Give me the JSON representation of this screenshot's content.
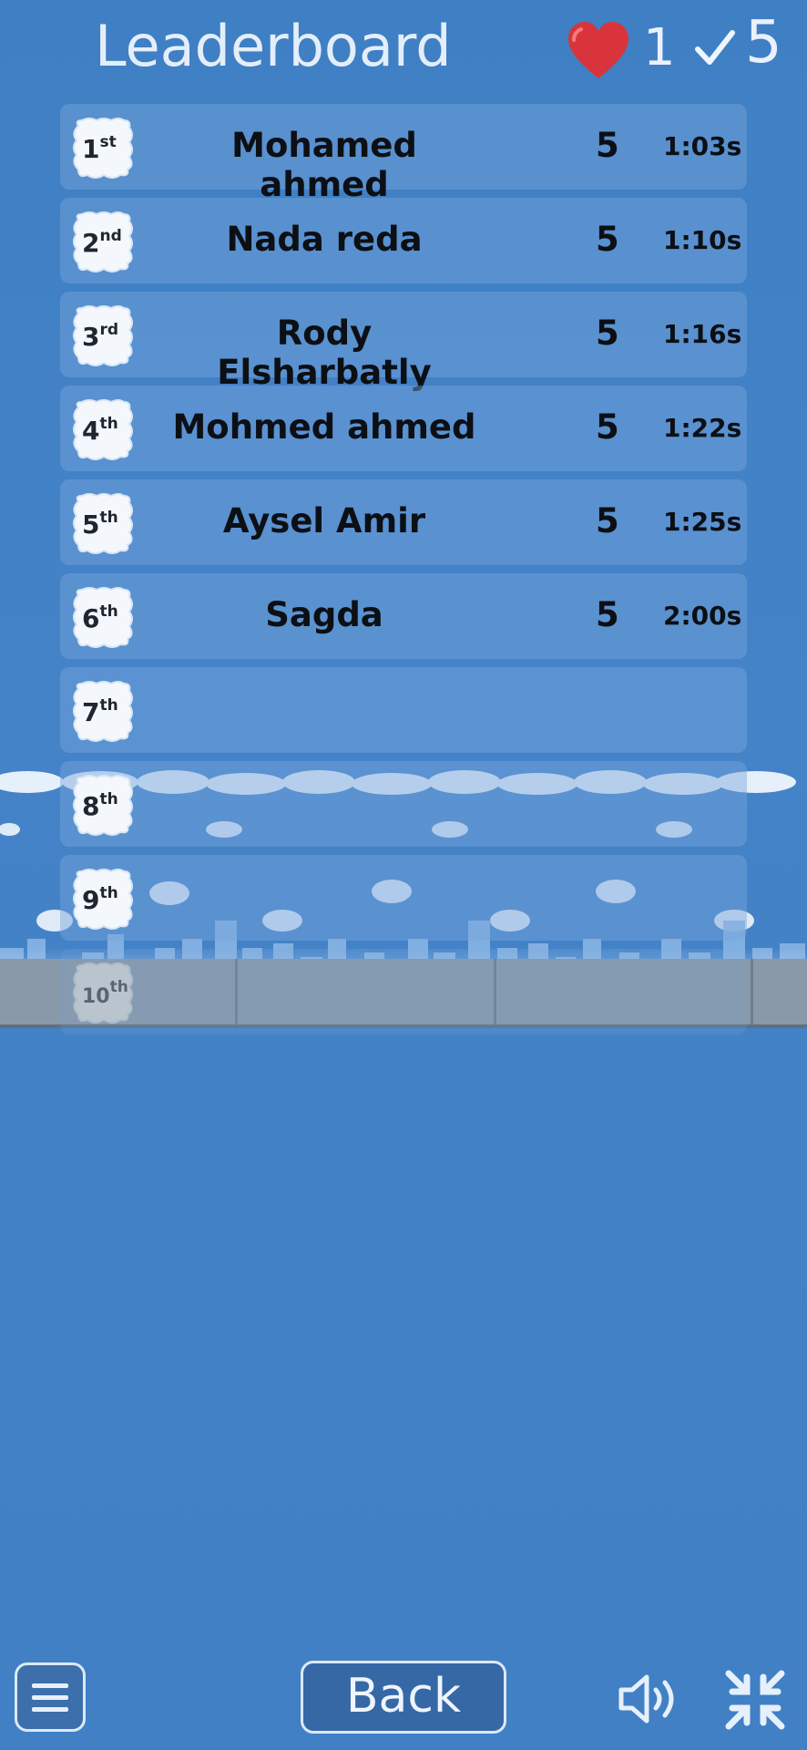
{
  "header": {
    "title": "Leaderboard",
    "lives": "1",
    "score": "5"
  },
  "icons": {
    "lives": "heart-icon",
    "score": "check-icon",
    "menu": "hamburger-icon",
    "sound": "speaker-icon",
    "shrink": "exit-fullscreen-icon"
  },
  "colors": {
    "heart": "#d9343b",
    "background": "#4182c7"
  },
  "leaderboard": [
    {
      "rank": "1",
      "suffix": "st",
      "name": "Mohamed ahmed",
      "points": "5",
      "time": "1:03s"
    },
    {
      "rank": "2",
      "suffix": "nd",
      "name": "Nada reda",
      "points": "5",
      "time": "1:10s"
    },
    {
      "rank": "3",
      "suffix": "rd",
      "name": "Rody Elsharbatly",
      "points": "5",
      "time": "1:16s"
    },
    {
      "rank": "4",
      "suffix": "th",
      "name": "Mohmed ahmed",
      "points": "5",
      "time": "1:22s"
    },
    {
      "rank": "5",
      "suffix": "th",
      "name": "Aysel Amir",
      "points": "5",
      "time": "1:25s"
    },
    {
      "rank": "6",
      "suffix": "th",
      "name": "Sagda",
      "points": "5",
      "time": "2:00s"
    },
    {
      "rank": "7",
      "suffix": "th",
      "name": "",
      "points": "",
      "time": ""
    },
    {
      "rank": "8",
      "suffix": "th",
      "name": "",
      "points": "",
      "time": ""
    },
    {
      "rank": "9",
      "suffix": "th",
      "name": "",
      "points": "",
      "time": ""
    },
    {
      "rank": "10",
      "suffix": "th",
      "name": "",
      "points": "",
      "time": ""
    }
  ],
  "footer": {
    "back_label": "Back"
  }
}
